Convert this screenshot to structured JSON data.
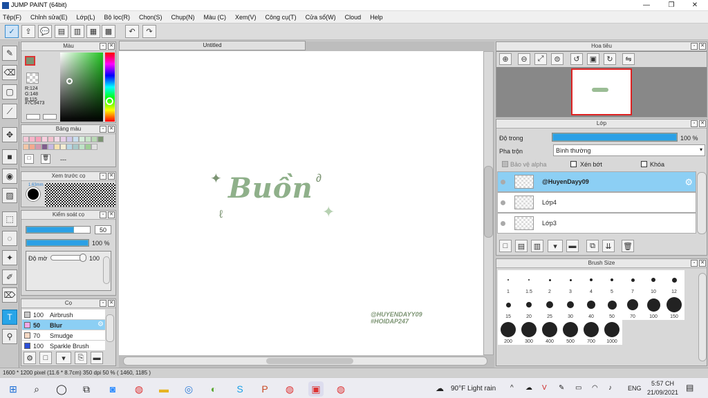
{
  "window": {
    "title": "JUMP PAINT (64bit)",
    "minimize": "—",
    "restore": "❐",
    "close": "✕"
  },
  "menu": [
    "Tệp(F)",
    "Chỉnh sửa(E)",
    "Lớp(L)",
    "Bộ lọc(R)",
    "Chọn(S)",
    "Chụp(N)",
    "Màu (C)",
    "Xem(V)",
    "Công cụ(T)",
    "Cửa sổ(W)",
    "Cloud",
    "Help"
  ],
  "color_panel": {
    "title": "Màu",
    "r": "R:124",
    "g": "G:148",
    "b": "B:115",
    "hex": "#7C9473",
    "current_color": "#7c9473"
  },
  "swatch_panel": {
    "title": "Bảng màu",
    "dash": "---",
    "colors": [
      "#f6c9d8",
      "#f8b5c9",
      "#f7a1b9",
      "#f9d0e0",
      "#f4c1cf",
      "#f3dbe8",
      "#e8cfe8",
      "#d0c9ea",
      "#c9dff0",
      "#d6eedb",
      "#c9e6c9",
      "#b8d9b4",
      "#7c9473",
      "#f2c7a8",
      "#f3a98f",
      "#d49ab0",
      "#7f5e8c",
      "#c7b9e3",
      "#f7e2b0",
      "#f4edd4",
      "#b7d7e6",
      "#a8c9c9",
      "#bfe3c8",
      "#9fcf96",
      "#e0e0e0"
    ]
  },
  "brush_preview": {
    "title": "Xem trước cọ",
    "size": "1.63mm"
  },
  "brush_control": {
    "title": "Kiểm soát cọ",
    "size_value": "50",
    "opacity_value": "100 %",
    "opacity_pct": 100,
    "size_pct": 75,
    "blur_label": "Độ mờ",
    "blur_value": "100"
  },
  "brush_list": {
    "title": "Cọ",
    "items": [
      {
        "size": "100",
        "name": "Airbrush",
        "color": "#c8c8c8",
        "selected": false
      },
      {
        "size": "50",
        "name": "Blur",
        "color": "#f3a7e8",
        "selected": true
      },
      {
        "size": "70",
        "name": "Smudge",
        "color": "#f6d9c4",
        "selected": false
      },
      {
        "size": "100",
        "name": "Sparkle Brush",
        "color": "#2c4fd8",
        "selected": false
      }
    ]
  },
  "document": {
    "tab": "Untitled",
    "artwork_title": "Buồn",
    "watermark_line1": "@HUYENDAYY09",
    "watermark_line2": "#HOIDAP247"
  },
  "navigator": {
    "title": "Hoa tiêu"
  },
  "layer_panel": {
    "title": "Lớp",
    "opacity_label": "Độ trong",
    "opacity_value": "100 %",
    "opacity_pct": 100,
    "blend_label": "Pha trộn",
    "blend_value": "Bình thường",
    "protect_alpha": "Bảo vệ alpha",
    "clipping": "Xén bớt",
    "lock": "Khóa",
    "layers": [
      {
        "name": "@HuyenDayy09",
        "selected": true
      },
      {
        "name": "Lớp4",
        "selected": false
      },
      {
        "name": "Lớp3",
        "selected": false
      }
    ]
  },
  "brush_size": {
    "title": "Brush Size",
    "sizes": [
      "1",
      "1.5",
      "2",
      "3",
      "4",
      "5",
      "7",
      "10",
      "12",
      "15",
      "20",
      "25",
      "30",
      "40",
      "50",
      "70",
      "100",
      "150",
      "200",
      "300",
      "400",
      "500",
      "700",
      "1000"
    ]
  },
  "status": {
    "text": "1600 * 1200 pixel  (11.6 * 8.7cm)  350 dpi  50 %  ( 1460, 1185 )"
  },
  "taskbar": {
    "weather": "90°F  Light rain",
    "lang": "ENG",
    "time": "5:57 CH",
    "date": "21/09/2021"
  }
}
